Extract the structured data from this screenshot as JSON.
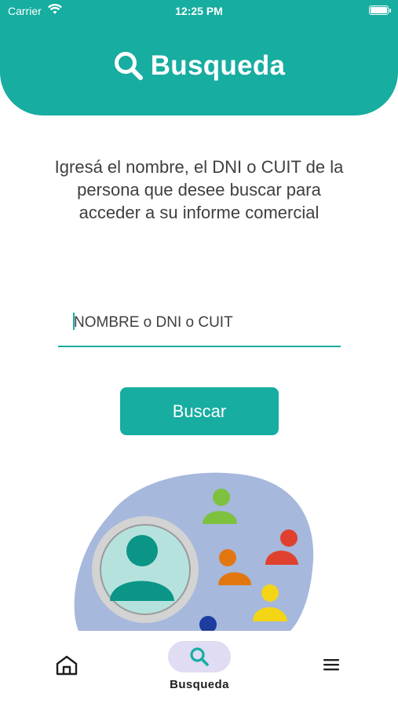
{
  "status_bar": {
    "carrier": "Carrier",
    "time": "12:25 PM"
  },
  "header": {
    "title": "Busqueda",
    "icon": "search-icon"
  },
  "description": "Igresá el nombre, el DNI o CUIT de la persona que desee buscar para acceder a su informe comercial",
  "search": {
    "placeholder": "NOMBRE o DNI o CUIT",
    "value": ""
  },
  "buscar_label": "Buscar",
  "tabs": [
    {
      "name": "home",
      "icon": "home-icon",
      "label": ""
    },
    {
      "name": "search",
      "icon": "search-icon",
      "label": "Busqueda",
      "active": true
    },
    {
      "name": "menu",
      "icon": "menu-icon",
      "label": ""
    }
  ],
  "colors": {
    "brand": "#17ada1",
    "active_tab_pill": "#dfdcf3",
    "text": "#3f3f3f"
  }
}
